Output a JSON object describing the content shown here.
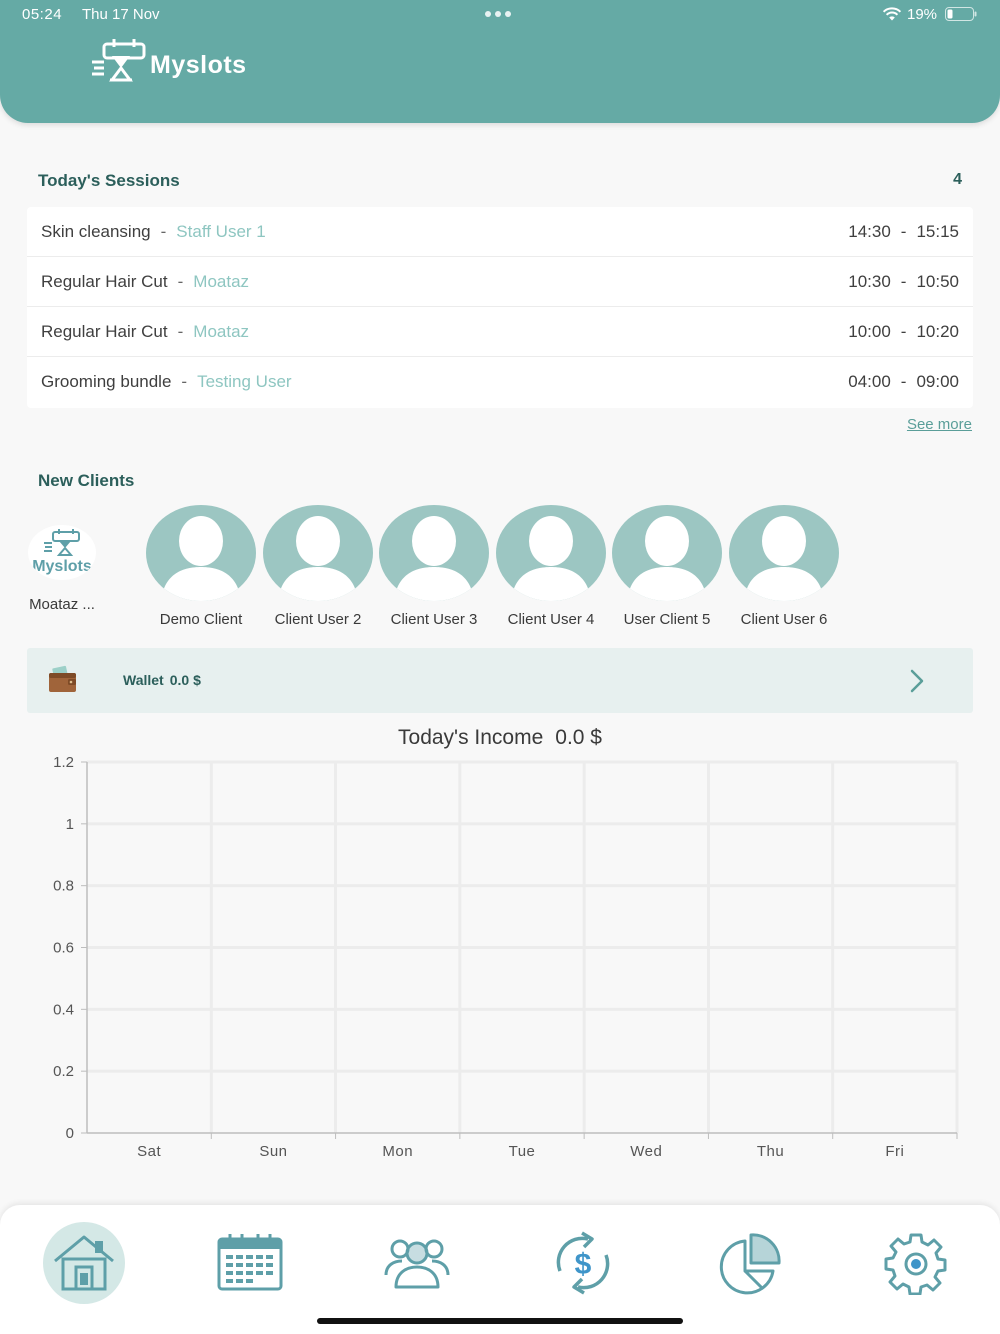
{
  "status": {
    "time": "05:24",
    "date": "Thu 17 Nov",
    "battery": "19%"
  },
  "header": {
    "app_name": "Myslots"
  },
  "sessions": {
    "title": "Today's Sessions",
    "count": "4",
    "separator": "-",
    "items": [
      {
        "service": "Skin cleansing",
        "staff": "Staff User 1",
        "start": "14:30",
        "end": "15:15"
      },
      {
        "service": "Regular Hair Cut",
        "staff": "Moataz",
        "start": "10:30",
        "end": "10:50"
      },
      {
        "service": "Regular Hair Cut",
        "staff": "Moataz",
        "start": "10:00",
        "end": "10:20"
      },
      {
        "service": "Grooming bundle",
        "staff": "Testing User",
        "start": "04:00",
        "end": "09:00"
      }
    ],
    "see_more": "See more"
  },
  "clients": {
    "title": "New Clients",
    "logo_text": "Myslots",
    "items": [
      {
        "name": "Moataz ..."
      },
      {
        "name": "Demo Client"
      },
      {
        "name": "Client User 2"
      },
      {
        "name": "Client User 3"
      },
      {
        "name": "Client User 4"
      },
      {
        "name": "User Client 5"
      },
      {
        "name": "Client User 6"
      }
    ]
  },
  "wallet": {
    "label": "Wallet",
    "amount": "0.0 $",
    "icon": "wallet-icon"
  },
  "chart_data": {
    "type": "bar",
    "title": "Today's Income",
    "title_value": "0.0 $",
    "categories": [
      "Sat",
      "Sun",
      "Mon",
      "Tue",
      "Wed",
      "Thu",
      "Fri"
    ],
    "values": [
      0,
      0,
      0,
      0,
      0,
      0,
      0
    ],
    "yticks": [
      "0",
      "0.2",
      "0.4",
      "0.6",
      "0.8",
      "1",
      "1.2"
    ],
    "ylim": [
      0,
      1.2
    ],
    "grid": true,
    "xlabel": "",
    "ylabel": ""
  },
  "tabs": [
    {
      "icon": "home-icon",
      "active": true
    },
    {
      "icon": "calendar-icon",
      "active": false
    },
    {
      "icon": "clients-icon",
      "active": false
    },
    {
      "icon": "income-icon",
      "active": false
    },
    {
      "icon": "reports-icon",
      "active": false
    },
    {
      "icon": "settings-icon",
      "active": false
    }
  ],
  "colors": {
    "primary": "#65aaa5",
    "accent_text": "#8ec6c1",
    "active_tab": "#d4e8e6",
    "icon": "#5e9fa8"
  }
}
